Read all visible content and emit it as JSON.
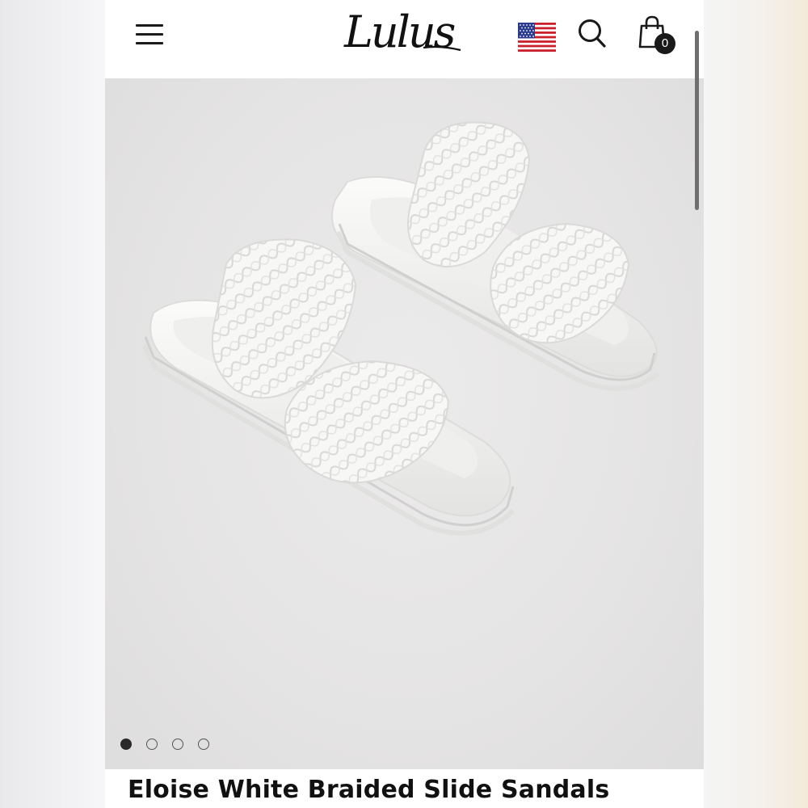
{
  "header": {
    "logo_text": "Lulus",
    "cart_count": "0",
    "icons": {
      "menu": "hamburger-menu-icon",
      "flag": "us-flag-icon",
      "search": "search-icon",
      "cart": "shopping-bag-icon"
    }
  },
  "gallery": {
    "image_alt": "white braided slide sandals",
    "image_count": 4,
    "active_index": 0
  },
  "product": {
    "title": "Eloise White Braided Slide Sandals"
  },
  "colors": {
    "background": "#ffffff",
    "gallery_bg": "#e6e5e5",
    "text": "#111111",
    "badge": "#1a1a1a"
  }
}
